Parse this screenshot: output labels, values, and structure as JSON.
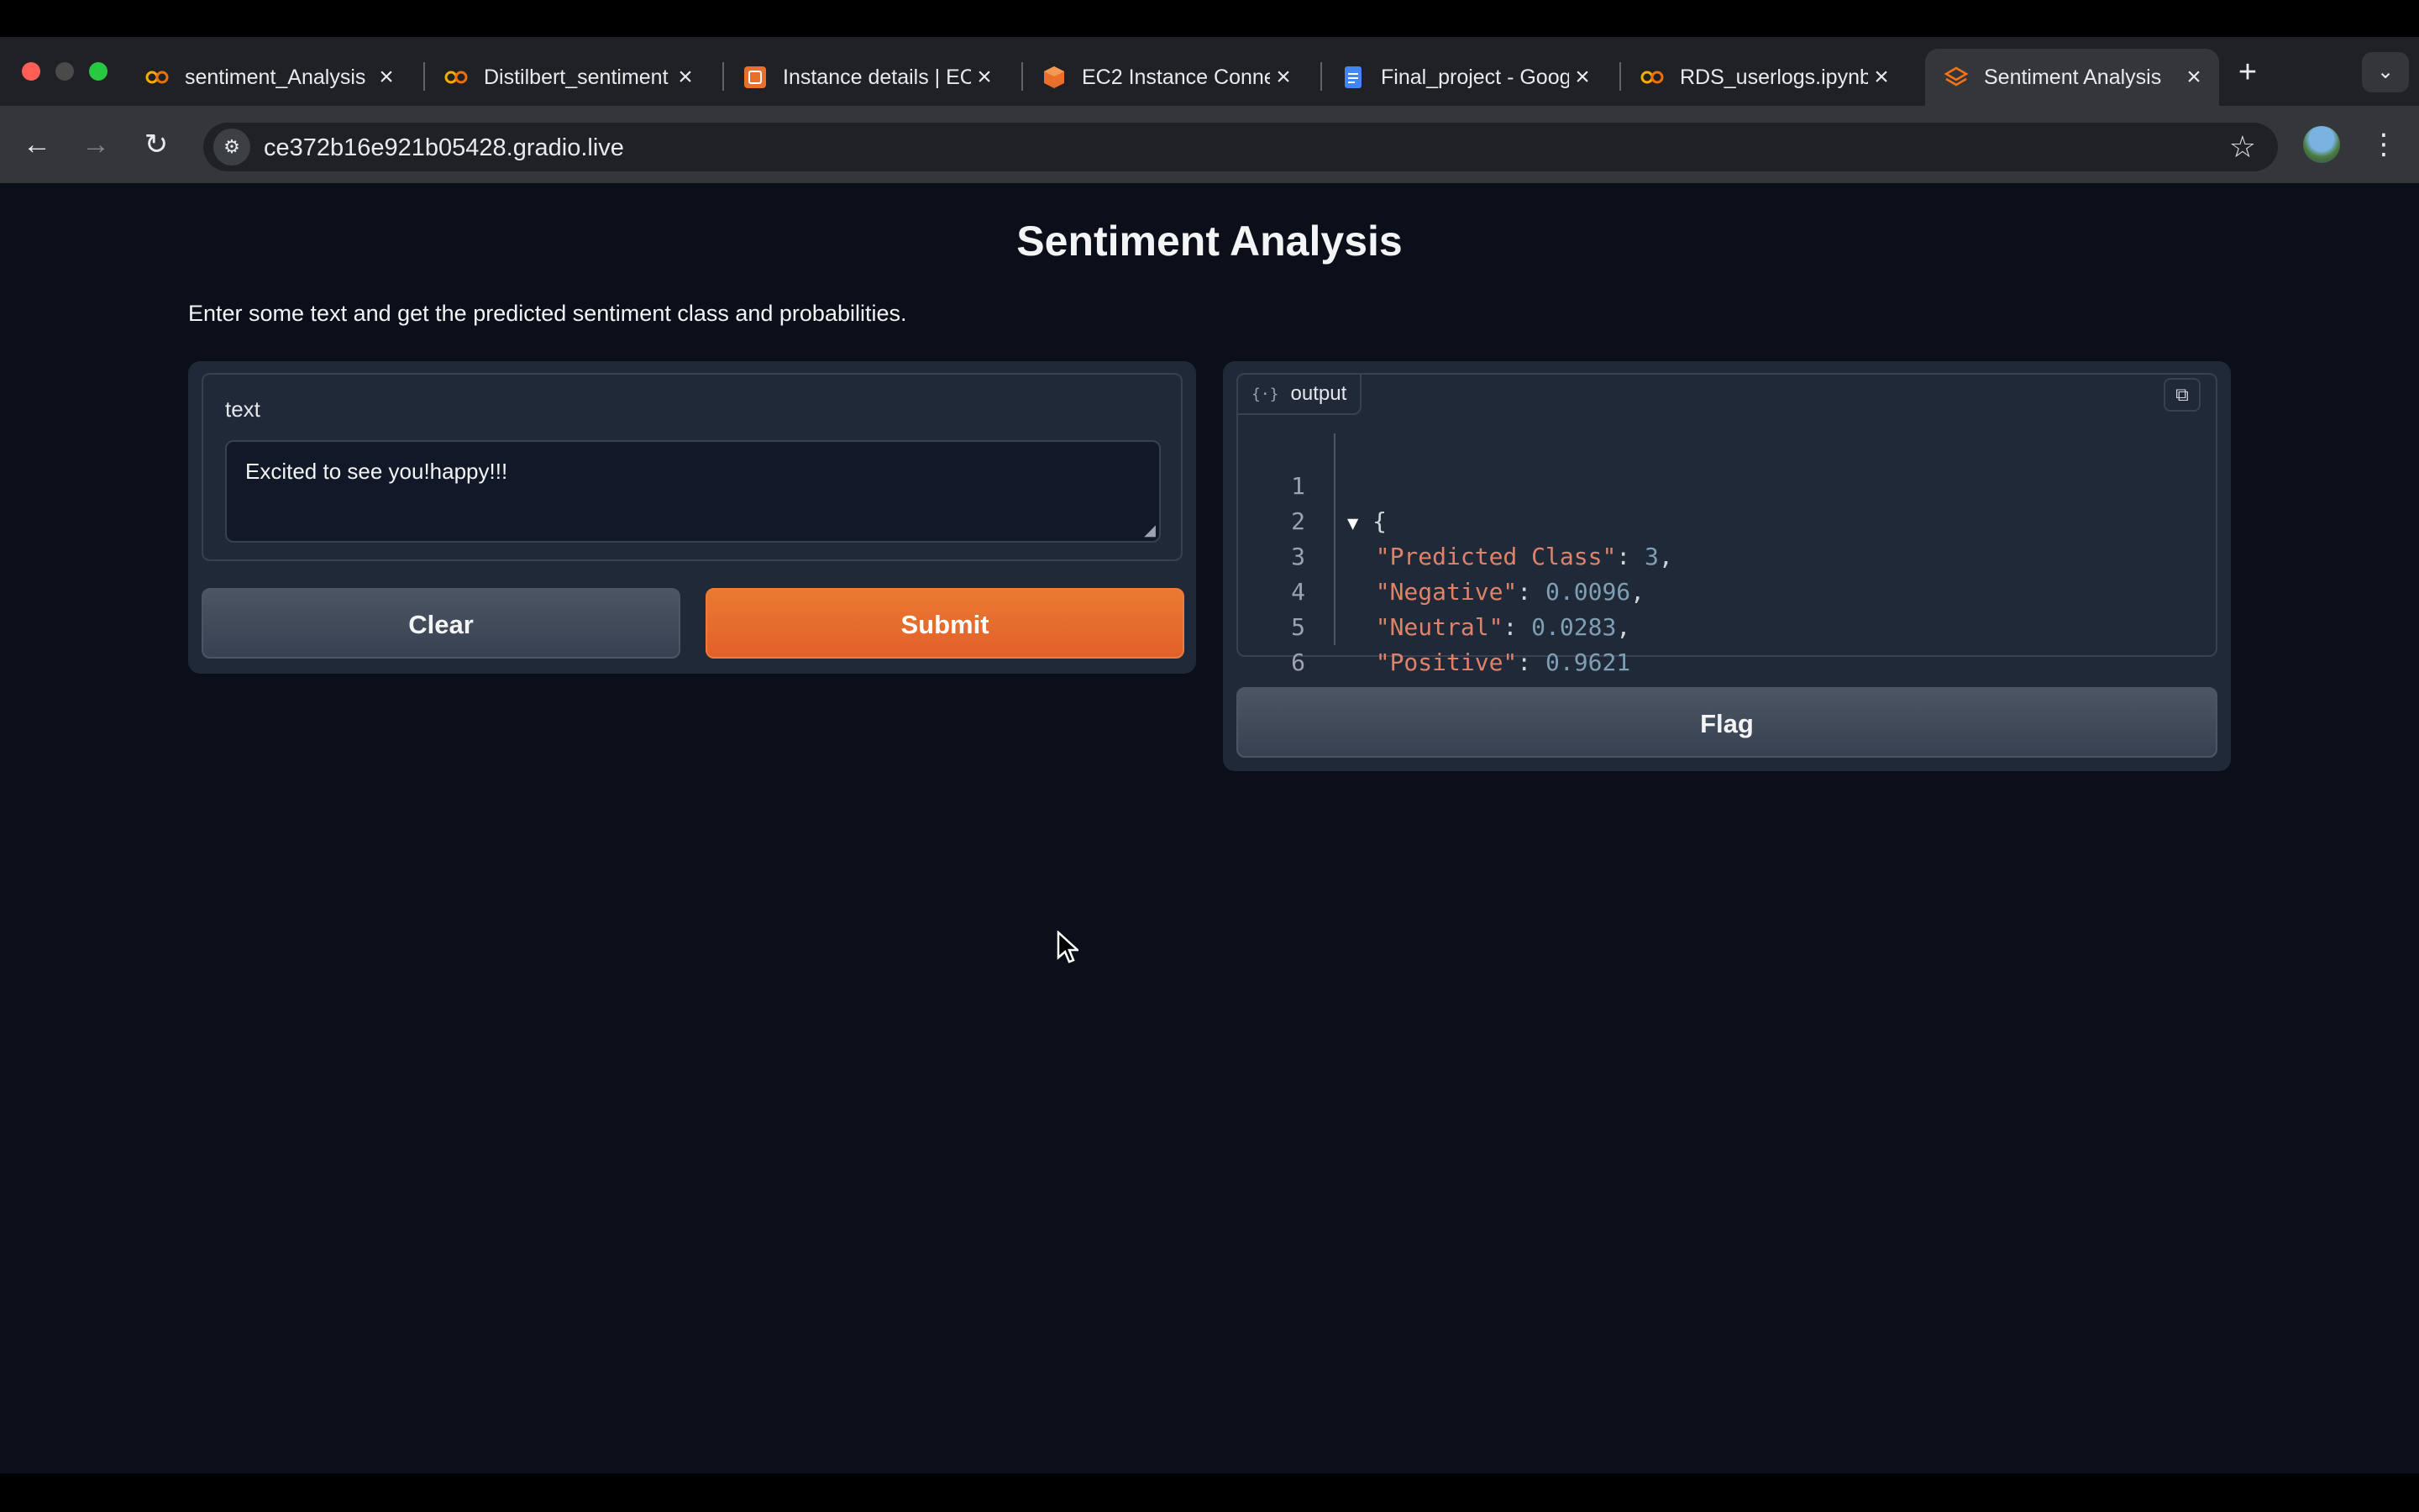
{
  "browser": {
    "tabs": [
      {
        "title": "sentiment_Analysis",
        "icon": "colab-icon"
      },
      {
        "title": "Distilbert_sentiment",
        "icon": "colab-icon"
      },
      {
        "title": "Instance details | EC2",
        "icon": "aws-icon"
      },
      {
        "title": "EC2 Instance Connect",
        "icon": "aws-cube-icon"
      },
      {
        "title": "Final_project - Google Docs",
        "icon": "docs-icon"
      },
      {
        "title": "RDS_userlogs.ipynb",
        "icon": "colab-icon"
      },
      {
        "title": "Sentiment Analysis",
        "icon": "gradio-icon",
        "active": true
      }
    ],
    "new_tab_glyph": "+",
    "url": "ce372b16e921b05428.gradio.live"
  },
  "app": {
    "title": "Sentiment Analysis",
    "description": "Enter some text and get the predicted sentiment class and probabilities.",
    "input": {
      "label": "text",
      "value": "Excited to see you!happy!!!"
    },
    "buttons": {
      "clear": "Clear",
      "submit": "Submit",
      "flag": "Flag"
    },
    "output": {
      "label": "output",
      "lines": [
        {
          "n": "1",
          "text": "{"
        },
        {
          "n": "2",
          "key": "\"Predicted Class\"",
          "value": "3",
          "comma": ","
        },
        {
          "n": "3",
          "key": "\"Negative\"",
          "value": "0.0096",
          "comma": ","
        },
        {
          "n": "4",
          "key": "\"Neutral\"",
          "value": "0.0283",
          "comma": ","
        },
        {
          "n": "5",
          "key": "\"Positive\"",
          "value": "0.9621",
          "comma": ""
        },
        {
          "n": "6",
          "text": "}"
        }
      ]
    }
  },
  "colors": {
    "accent": "#e8702c",
    "background": "#0b0f19",
    "panel": "#1f2937"
  }
}
